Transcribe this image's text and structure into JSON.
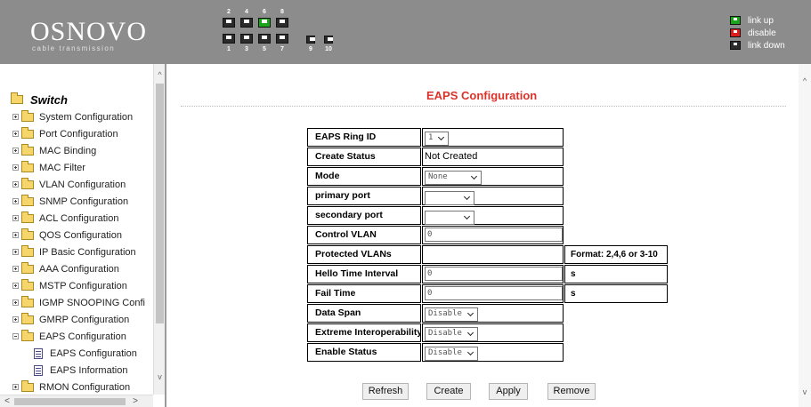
{
  "header": {
    "logo": "OSNOVO",
    "logo_sub": "cable transmission",
    "port_numbers_top": [
      "2",
      "4",
      "6",
      "8"
    ],
    "port_numbers_bottom": [
      "1",
      "3",
      "5",
      "7"
    ],
    "sfp_numbers": [
      "9",
      "10"
    ],
    "legend": [
      {
        "label": "link up",
        "color": "#1aa51a"
      },
      {
        "label": "disable",
        "color": "#e01b1b"
      },
      {
        "label": "link down",
        "color": "#2b2b2b"
      }
    ]
  },
  "sidebar": {
    "root": "Switch",
    "items": [
      "System Configuration",
      "Port Configuration",
      "MAC Binding",
      "MAC Filter",
      "VLAN Configuration",
      "SNMP Configuration",
      "ACL Configuration",
      "QOS Configuration",
      "IP Basic Configuration",
      "AAA Configuration",
      "MSTP Configuration",
      "IGMP SNOOPING Confi",
      "GMRP Configuration",
      "EAPS Configuration"
    ],
    "children": [
      "EAPS Configuration",
      "EAPS Information"
    ],
    "last_item": "RMON Configuration"
  },
  "main": {
    "title": "EAPS Configuration",
    "rows": [
      {
        "label": "EAPS Ring ID",
        "kind": "select",
        "value": "1"
      },
      {
        "label": "Create Status",
        "kind": "text",
        "value": "Not Created"
      },
      {
        "label": "Mode",
        "kind": "select",
        "value": "None"
      },
      {
        "label": "primary port",
        "kind": "select",
        "value": ""
      },
      {
        "label": "secondary port",
        "kind": "select",
        "value": ""
      },
      {
        "label": "Control VLAN",
        "kind": "input",
        "value": "0"
      },
      {
        "label": "Protected VLANs",
        "kind": "plain",
        "value": "",
        "extra": "Format: 2,4,6 or 3-10"
      },
      {
        "label": "Hello Time Interval",
        "kind": "input",
        "value": "0",
        "extra": "s"
      },
      {
        "label": "Fail Time",
        "kind": "input",
        "value": "0",
        "extra": "s"
      },
      {
        "label": "Data Span",
        "kind": "select",
        "value": "Disable"
      },
      {
        "label": "Extreme Interoperability",
        "kind": "select",
        "value": "Disable"
      },
      {
        "label": "Enable Status",
        "kind": "select",
        "value": "Disable"
      }
    ],
    "buttons": [
      "Refresh",
      "Create",
      "Apply",
      "Remove"
    ]
  }
}
